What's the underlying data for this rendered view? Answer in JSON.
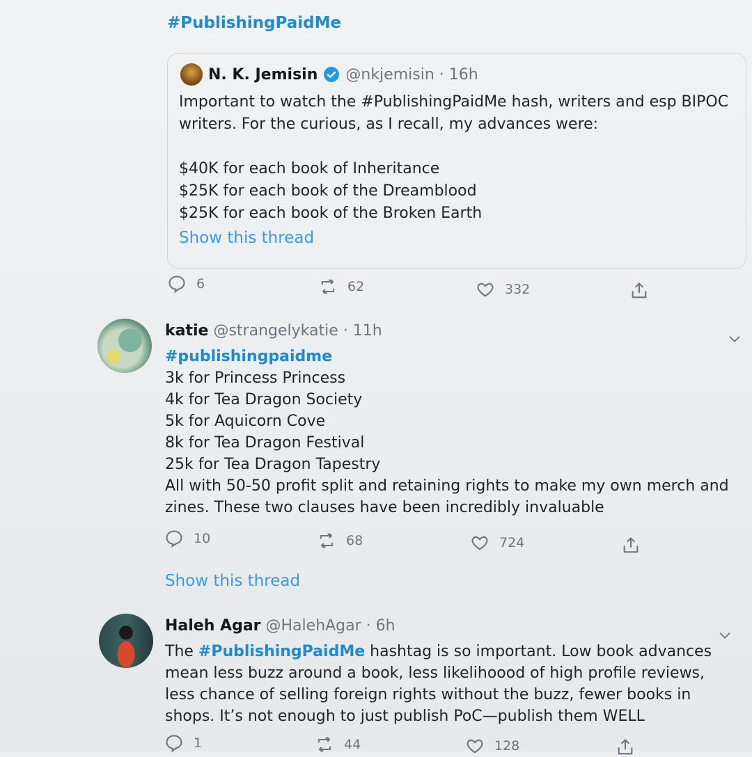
{
  "top": {
    "hashtag": "#PublishingPaidMe"
  },
  "quoted": {
    "name": "N. K. Jemisin",
    "handle_time": "@nkjemisin · 16h",
    "intro": "Important to watch the #PublishingPaidMe hash, writers and esp BIPOC writers. For the curious, as I recall, my advances were:",
    "lines": [
      "$40K for each book of Inheritance",
      "$25K for each book of the Dreamblood",
      "$25K for each book of the Broken Earth"
    ],
    "show_thread": "Show this thread"
  },
  "actions1": {
    "replies": "6",
    "retweets": "62",
    "likes": "332"
  },
  "katie": {
    "name": "katie",
    "handle_time": "@strangelykatie · 11h",
    "hashtag": "#publishingpaidme",
    "lines": [
      "3k for Princess Princess",
      "4k for Tea Dragon Society",
      "5k for Aquicorn Cove",
      "8k for Tea Dragon Festival",
      "25k for Tea Dragon Tapestry",
      "All with 50-50 profit split and retaining rights to make my own merch and zines. These two clauses have been incredibly invaluable"
    ],
    "replies": "10",
    "retweets": "68",
    "likes": "724",
    "show_thread": "Show this thread"
  },
  "haleh": {
    "name": "Haleh Agar",
    "handle_time": "@HalehAgar · 6h",
    "body_prefix": "The ",
    "hashtag": "#PublishingPaidMe",
    "body_rest": " hashtag is so important. Low book advances mean less buzz around a book, less likelihoood of high profile reviews, less chance of selling foreign rights without the buzz, fewer books in shops. It’s not enough to just publish PoC—publish them WELL",
    "replies": "1",
    "retweets": "44",
    "likes": "128"
  },
  "colors": {
    "link": "#1d8ad6",
    "muted": "#6b7680",
    "text": "#1f2428"
  },
  "icons": [
    "reply-icon",
    "retweet-icon",
    "like-icon",
    "share-icon",
    "verified-badge-icon",
    "chevron-down-icon"
  ]
}
